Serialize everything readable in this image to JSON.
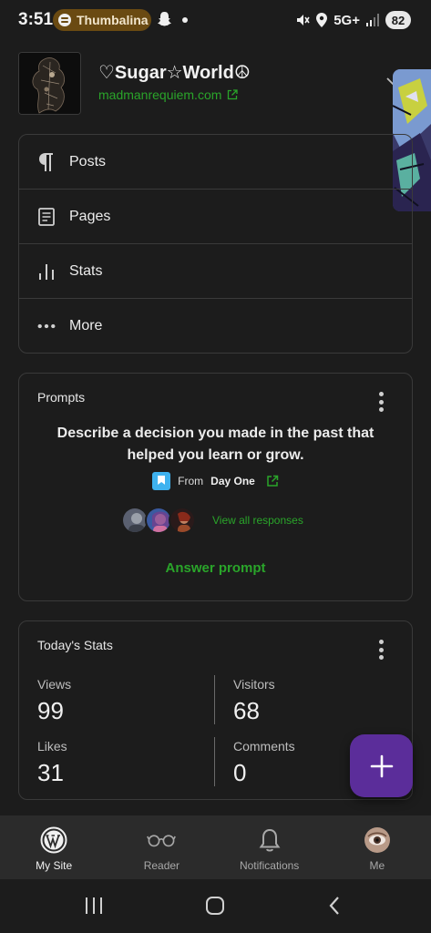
{
  "status_bar": {
    "time": "3:51",
    "media_pill": "Thumbalina",
    "network": "5G+",
    "battery": "82"
  },
  "site": {
    "title": "♡Sugar☆World☮",
    "url": "madmanrequiem.com"
  },
  "menu": {
    "items": [
      {
        "label": "Posts",
        "icon": "paragraph-icon"
      },
      {
        "label": "Pages",
        "icon": "page-icon"
      },
      {
        "label": "Stats",
        "icon": "stats-bars-icon"
      },
      {
        "label": "More",
        "icon": "ellipsis-icon"
      }
    ]
  },
  "prompts": {
    "title": "Prompts",
    "question": "Describe a decision you made in the past that helped you learn or grow.",
    "from_prefix": "From",
    "from_source": "Day One",
    "view_all": "View all responses",
    "answer": "Answer prompt"
  },
  "stats": {
    "title": "Today's Stats",
    "views_label": "Views",
    "views": "99",
    "visitors_label": "Visitors",
    "visitors": "68",
    "likes_label": "Likes",
    "likes": "31",
    "comments_label": "Comments",
    "comments": "0"
  },
  "tabs": [
    {
      "label": "My Site",
      "icon": "wordpress-icon",
      "active": true
    },
    {
      "label": "Reader",
      "icon": "glasses-icon"
    },
    {
      "label": "Notifications",
      "icon": "bell-icon"
    },
    {
      "label": "Me",
      "icon": "profile-avatar"
    }
  ],
  "colors": {
    "background": "#1c1c1c",
    "accent_green": "#2aa52a",
    "fab_purple": "#5b2d9a",
    "tabbar": "#2b2b2b"
  }
}
